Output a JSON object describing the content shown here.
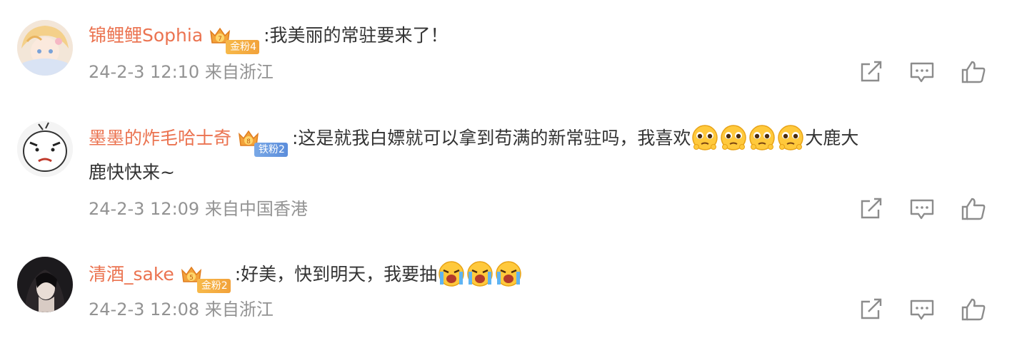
{
  "comments": [
    {
      "username": "锦鲤鲤Sophia",
      "badge": {
        "label": "金粉4",
        "level": "7",
        "type": "gold"
      },
      "text": ":我美丽的常驻要来了！",
      "timestamp": "24-2-3 12:10",
      "location": "来自浙江"
    },
    {
      "username": "墨墨的炸毛哈士奇",
      "badge": {
        "label": "铁粉2",
        "level": "8",
        "type": "iron"
      },
      "text_line1": ":这是就我白嫖就可以拿到苟满的新常驻吗，我喜欢",
      "emoji": "pleading-face",
      "text_line1_end": "大鹿大",
      "text_line2": "鹿快快来~",
      "timestamp": "24-2-3 12:09",
      "location": "来自中国香港"
    },
    {
      "username": "清酒_sake",
      "badge": {
        "label": "金粉2",
        "level": "5",
        "type": "gold"
      },
      "text": ":好美，快到明天，我要抽",
      "emoji": "crying-face",
      "timestamp": "24-2-3 12:08",
      "location": "来自浙江"
    }
  ],
  "action_icons": [
    "share-icon",
    "comment-icon",
    "like-icon"
  ],
  "colors": {
    "username": "#eb7350",
    "meta": "#939393",
    "text": "#333333",
    "icon": "#8c8c8c"
  }
}
